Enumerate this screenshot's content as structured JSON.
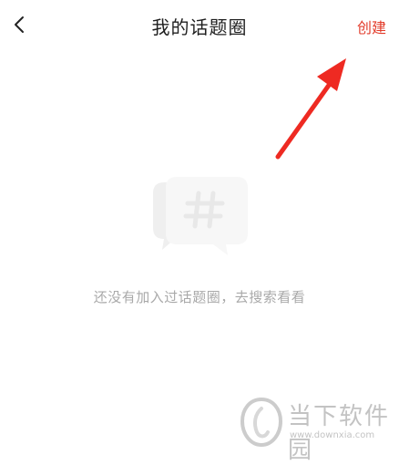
{
  "header": {
    "title": "我的话题圈",
    "create_label": "创建"
  },
  "empty_state": {
    "message": "还没有加入过话题圈，去搜索看看"
  },
  "watermark": {
    "name_cn": "当下软件园",
    "url": "www.downxia.com"
  },
  "colors": {
    "accent": "#e23b2a",
    "title": "#1f1f1f",
    "muted": "#a9a9a9"
  },
  "icons": {
    "back": "chevron-left-icon",
    "empty": "hashtag-bubble-icon",
    "annotation": "red-arrow-icon"
  }
}
